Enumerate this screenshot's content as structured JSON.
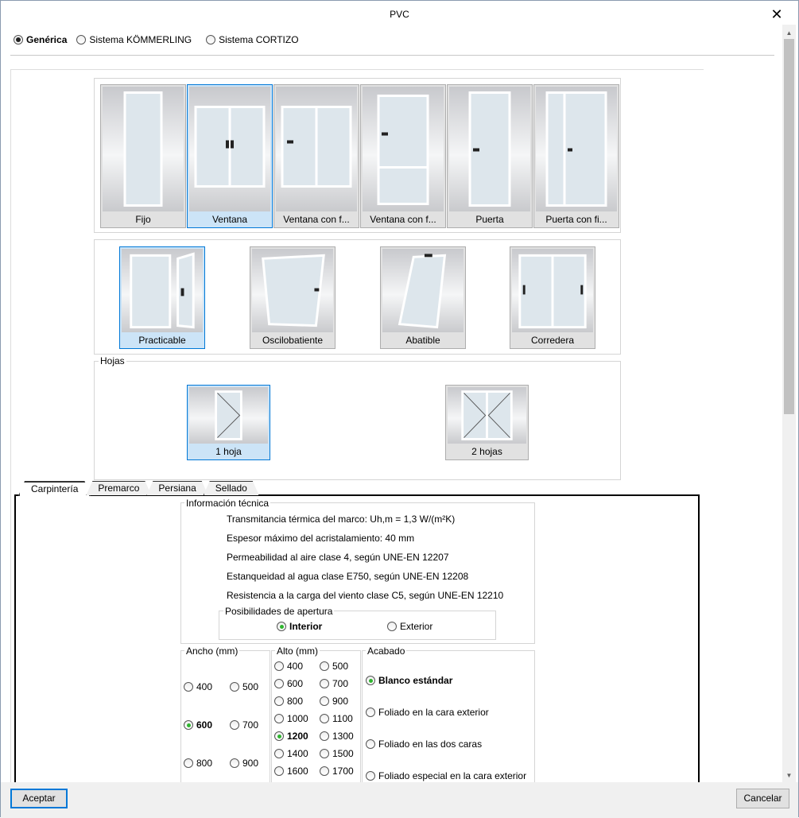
{
  "window": {
    "title": "PVC",
    "close_icon": "close-icon"
  },
  "system": {
    "options": [
      "Genérica",
      "Sistema KÖMMERLING",
      "Sistema CORTIZO"
    ],
    "selected": 0
  },
  "types": {
    "items": [
      {
        "label": "Fijo",
        "icon": "fixed"
      },
      {
        "label": "Ventana",
        "icon": "window2"
      },
      {
        "label": "Ventana con f...",
        "icon": "window-side"
      },
      {
        "label": "Ventana con f...",
        "icon": "window-bottom"
      },
      {
        "label": "Puerta",
        "icon": "door"
      },
      {
        "label": "Puerta con fi...",
        "icon": "door-side"
      }
    ],
    "selected": 1
  },
  "opening": {
    "items": [
      {
        "label": "Practicable",
        "icon": "casement"
      },
      {
        "label": "Oscilobatiente",
        "icon": "tilt-turn"
      },
      {
        "label": "Abatible",
        "icon": "tilt"
      },
      {
        "label": "Corredera",
        "icon": "sliding"
      }
    ],
    "selected": 0
  },
  "leaves": {
    "legend": "Hojas",
    "items": [
      {
        "label": "1 hoja",
        "icon": "one-leaf"
      },
      {
        "label": "2 hojas",
        "icon": "two-leaves"
      }
    ],
    "selected": 0
  },
  "tabs": [
    "Carpintería",
    "Premarco",
    "Persiana",
    "Sellado"
  ],
  "tech": {
    "legend": "Información técnica",
    "lines": [
      "Transmitancia térmica del marco: Uh,m = 1,3 W/(m²K)",
      "Espesor máximo del acristalamiento: 40 mm",
      "Permeabilidad al aire clase 4, según UNE-EN 12207",
      "Estanqueidad al agua clase E750, según UNE-EN 12208",
      "Resistencia a la carga del viento clase C5, según UNE-EN 12210"
    ],
    "apertura": {
      "legend": "Posibilidades de apertura",
      "options": [
        "Interior",
        "Exterior"
      ],
      "selected": 0
    }
  },
  "ancho": {
    "legend": "Ancho (mm)",
    "options": [
      "400",
      "500",
      "600",
      "700",
      "800",
      "900"
    ],
    "selected": "600"
  },
  "alto": {
    "legend": "Alto (mm)",
    "options": [
      "400",
      "500",
      "600",
      "700",
      "800",
      "900",
      "1000",
      "1100",
      "1200",
      "1300",
      "1400",
      "1500",
      "1600",
      "1700"
    ],
    "selected": "1200"
  },
  "acabado": {
    "legend": "Acabado",
    "options": [
      "Blanco estándar",
      "Foliado en la cara exterior",
      "Foliado en las dos caras",
      "Foliado especial en la cara exterior"
    ],
    "selected": 0
  },
  "buttons": {
    "accept": "Aceptar",
    "cancel": "Cancelar"
  }
}
